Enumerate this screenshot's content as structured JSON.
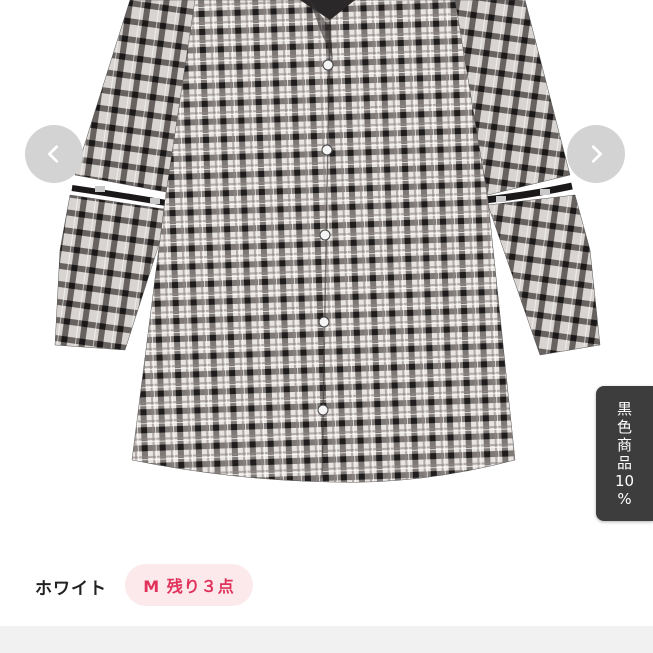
{
  "product": {
    "image_alt": "plaid shirt dress",
    "color_name": "ホワイト",
    "stock_badge": "M 残り３点",
    "stock_color": "#e0325a",
    "stock_bg": "#fbe9ec"
  },
  "carousel": {
    "prev_icon": "chevron-left-icon",
    "next_icon": "chevron-right-icon"
  },
  "promo": {
    "chars": [
      "黒",
      "色",
      "商",
      "品",
      "10",
      "%"
    ]
  }
}
